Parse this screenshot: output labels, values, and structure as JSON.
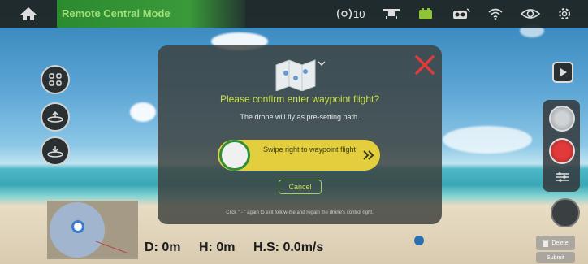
{
  "topbar": {
    "mode_label": "Remote Central Mode",
    "satellite_count": "10",
    "icons": [
      "home-icon",
      "satellite-icon",
      "drone-icon",
      "battery-icon",
      "camera-icon",
      "wifi-icon",
      "eye-icon",
      "gear-icon"
    ]
  },
  "left_toolbar": {
    "icons": [
      "grid-icon",
      "takeoff-icon",
      "landing-icon"
    ]
  },
  "dialog": {
    "title": "Please confirm enter waypoint flight?",
    "description": "The drone will fly as pre-setting path.",
    "swipe_label": "Swipe right to waypoint flight",
    "cancel_label": "Cancel",
    "hint": "Click \" - \" again to exit follow-me and regain the drone's control right."
  },
  "telemetry": {
    "distance": "D: 0m",
    "height": "H: 0m",
    "hspeed": "H.S: 0.0m/s"
  },
  "right_panel": {
    "delete_label": "Delete",
    "submit_label": "Submit"
  },
  "colors": {
    "accent_green": "#3a9a3a",
    "dialog_title": "#c8e04a",
    "swipe_yellow": "#e3cf3e",
    "close_red": "#e03a3a"
  }
}
